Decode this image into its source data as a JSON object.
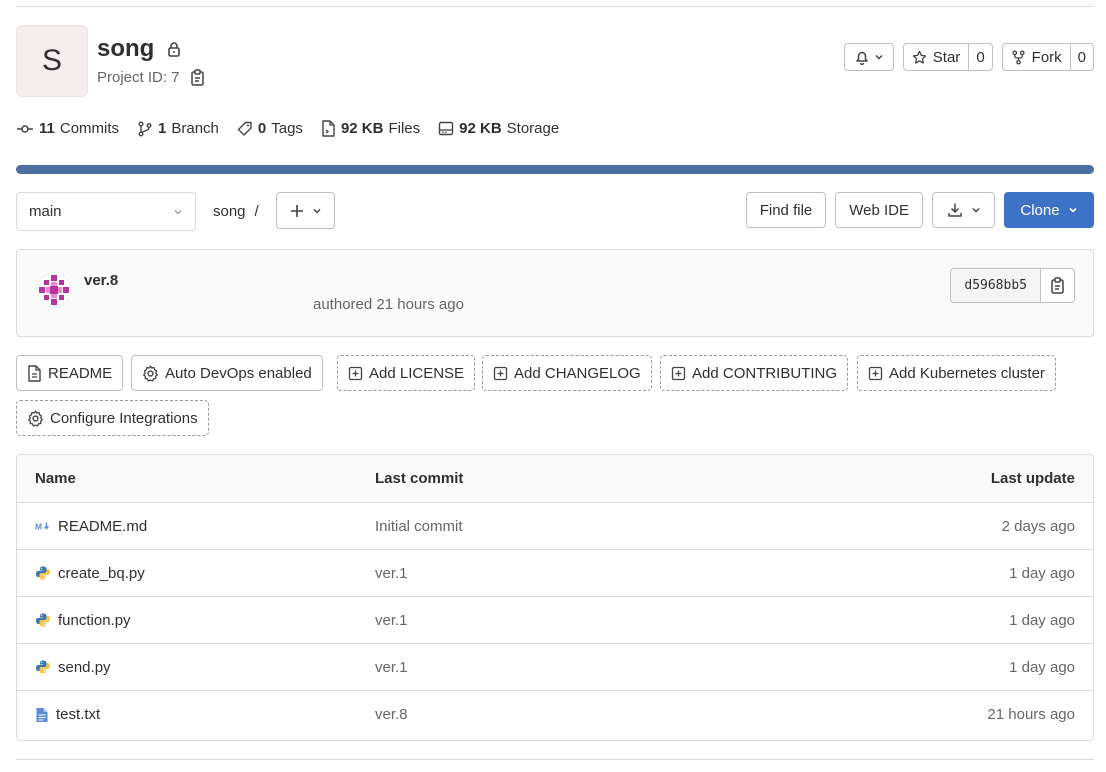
{
  "project": {
    "avatar_letter": "S",
    "name": "song",
    "id_text": "Project ID: 7"
  },
  "header_actions": {
    "star_label": "Star",
    "star_count": "0",
    "fork_label": "Fork",
    "fork_count": "0"
  },
  "stats": {
    "commits_count": "11",
    "commits_label": "Commits",
    "branch_count": "1",
    "branch_label": "Branch",
    "tags_count": "0",
    "tags_label": "Tags",
    "files_size": "92 KB",
    "files_label": "Files",
    "storage_size": "92 KB",
    "storage_label": "Storage"
  },
  "toolbar": {
    "branch": "main",
    "breadcrumb": "song",
    "breadcrumb_sep": "/",
    "find_file": "Find file",
    "web_ide": "Web IDE",
    "clone": "Clone"
  },
  "last_commit": {
    "title": "ver.8",
    "meta": "authored 21 hours ago",
    "sha": "d5968bb5"
  },
  "quick_links": [
    {
      "label": "README",
      "style": "solid",
      "icon": "file-icon"
    },
    {
      "label": "Auto DevOps enabled",
      "style": "solid",
      "icon": "gear-icon"
    },
    {
      "label": "Add LICENSE",
      "style": "dashed",
      "icon": "plus-square-icon"
    },
    {
      "label": "Add CHANGELOG",
      "style": "dashed",
      "icon": "plus-square-icon"
    },
    {
      "label": "Add CONTRIBUTING",
      "style": "dashed",
      "icon": "plus-square-icon"
    },
    {
      "label": "Add Kubernetes cluster",
      "style": "dashed",
      "icon": "plus-square-icon"
    },
    {
      "label": "Configure Integrations",
      "style": "dashed",
      "icon": "gear-icon"
    }
  ],
  "file_table": {
    "headers": [
      "Name",
      "Last commit",
      "Last update"
    ],
    "rows": [
      {
        "name": "README.md",
        "icon": "markdown-icon",
        "commit": "Initial commit",
        "updated": "2 days ago"
      },
      {
        "name": "create_bq.py",
        "icon": "python-icon",
        "commit": "ver.1",
        "updated": "1 day ago"
      },
      {
        "name": "function.py",
        "icon": "python-icon",
        "commit": "ver.1",
        "updated": "1 day ago"
      },
      {
        "name": "send.py",
        "icon": "python-icon",
        "commit": "ver.1",
        "updated": "1 day ago"
      },
      {
        "name": "test.txt",
        "icon": "text-file-icon",
        "commit": "ver.8",
        "updated": "21 hours ago"
      }
    ]
  },
  "colors": {
    "accent": "#3e72c6",
    "progress": "#4c6f9f",
    "avatar_bg": "#f6eeee"
  }
}
